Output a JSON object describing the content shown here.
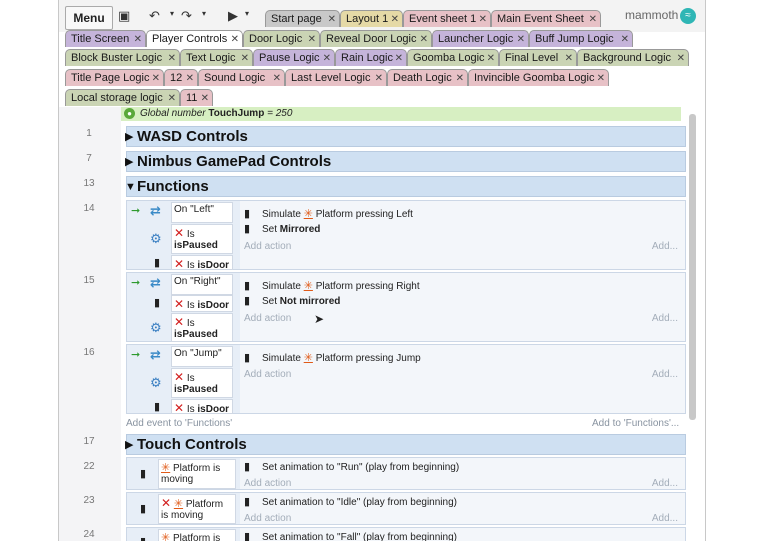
{
  "toolbar": {
    "menu_label": "Menu",
    "brand": "mammoth"
  },
  "tabs": {
    "row1": [
      "Start page",
      "Layout 1",
      "Event sheet 1",
      "Main Event Sheet"
    ],
    "row2": [
      "Title Screen",
      "Player Controls",
      "Door Logic",
      "Reveal Door Logic",
      "Launcher Logic",
      "Buff Jump Logic"
    ],
    "row3": [
      "Block Buster Logic",
      "Text Logic",
      "Pause Logic",
      "Rain Logic",
      "Goomba Logic",
      "Final Level",
      "Background Logic"
    ],
    "row4": [
      "Title Page Logic",
      "12",
      "Sound Logic",
      "Last Level Logic",
      "Death Logic",
      "Invincible Goomba Logic"
    ],
    "row5": [
      "Local storage logic",
      "11"
    ]
  },
  "sheet": {
    "global_label": "Global number",
    "global_name": "TouchJump",
    "global_value": "= 250",
    "row_numbers": [
      "1",
      "7",
      "13",
      "14",
      "15",
      "16",
      "17",
      "22",
      "23",
      "24"
    ],
    "groups": [
      "WASD Controls",
      "Nimbus GamePad Controls",
      "Functions",
      "Touch Controls"
    ],
    "is_label": "Is",
    "ispaused": "isPaused",
    "isdoor": "isDoor",
    "on_left": "On \"Left\"",
    "on_right": "On \"Right\"",
    "on_jump": "On \"Jump\"",
    "simulate": "Simulate",
    "press_left": "Platform pressing Left",
    "press_right": "Platform pressing Right",
    "press_jump": "Platform pressing Jump",
    "set": "Set",
    "mirrored": "Mirrored",
    "not_mirrored": "Not mirrored",
    "add_action": "Add action",
    "add_right": "Add...",
    "add_event_to": "Add event to 'Functions'",
    "add_to": "Add to 'Functions'...",
    "platform": "Platform",
    "is_moving": "is moving",
    "platform_is": "Platform is",
    "moving": "moving",
    "anim_run": "Set animation to \"Run\" (play from beginning)",
    "anim_idle": "Set animation to \"Idle\" (play from beginning)",
    "anim_fall": "Set animation to \"Fall\" (play from beginning)",
    "platform_cut": "Platform is"
  },
  "icons": {
    "save": "save-icon",
    "undo": "undo-icon",
    "redo": "redo-icon",
    "play": "play-icon",
    "player": "player-body-icon",
    "platform": "platform-run-icon",
    "function": "function-icon",
    "system": "gear-icon",
    "invert": "invert-x-icon",
    "trigger": "green-arrow-icon"
  },
  "colors": {
    "group_bg": "#cfe0f2",
    "event_bg": "#e7eef7",
    "global_bg": "#d7efc2",
    "tab_active": "#ffffff",
    "accent_red": "#d22020",
    "accent_orange": "#e05a18"
  }
}
